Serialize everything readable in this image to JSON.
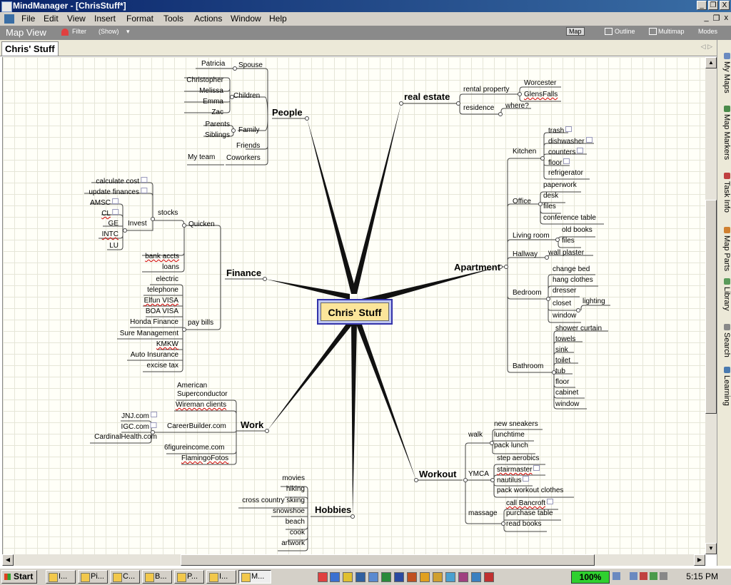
{
  "window": {
    "title": "MindManager - [ChrisStuff*]",
    "min": "_",
    "max": "❐",
    "close": "X"
  },
  "menu": [
    "File",
    "Edit",
    "View",
    "Insert",
    "Format",
    "Tools",
    "Actions",
    "Window",
    "Help"
  ],
  "mdi_controls": {
    "min": "_",
    "restore": "❐",
    "close": "x"
  },
  "viewbar": {
    "title": "Map View",
    "filter": "Filter",
    "show": "(Show)",
    "views": [
      "Map",
      "Outline",
      "Multimap"
    ],
    "modes": "Modes",
    "selected_view": "Map"
  },
  "document_tab": {
    "label": "Chris' Stuff",
    "nav": "◁ ▷"
  },
  "map": {
    "central": "Chris' Stuff",
    "people": {
      "label": "People",
      "spouse": "Spouse",
      "patricia": "Patricia",
      "children": "Children",
      "kids": [
        "Christopher",
        "Melissa",
        "Emma",
        "Zac"
      ],
      "family": "Family",
      "family_items": [
        "Parents",
        "Siblings"
      ],
      "friends": "Friends",
      "coworkers": "Coworkers",
      "myteam": "My team"
    },
    "finance": {
      "label": "Finance",
      "quicken": "Quicken",
      "stocks": "stocks",
      "stocks_items": [
        "calculate cost",
        "update finances"
      ],
      "invest": "Invest",
      "invest_items": [
        "AMSC",
        "CL",
        "GE",
        "INTC",
        "LU"
      ],
      "bank": "bank accts",
      "loans": "loans",
      "paybills": "pay bills",
      "bills": [
        "electric",
        "telephone",
        "Elfun VISA",
        "BOA VISA",
        "Honda Finance",
        "Sure Management",
        "KMKW",
        "Auto Insurance",
        "excise tax"
      ]
    },
    "work": {
      "label": "Work",
      "amsc1": "American",
      "amsc2": "Superconductor",
      "wireman": "Wireman clients",
      "careerbuilder": "CareerBuilder.com",
      "cb_items": [
        "JNJ.com",
        "IGC.com",
        "CardinalHealth.com"
      ],
      "sixfigure": "6figureincome.com",
      "flamingo": "FlamingoFotos"
    },
    "hobbies": {
      "label": "Hobbies",
      "items": [
        "movies",
        "hiking",
        "cross country skiing",
        "snowshoe",
        "beach",
        "cook",
        "artwork"
      ]
    },
    "realestate": {
      "label": "real estate",
      "rental": "rental property",
      "rental_items": [
        "Worcester",
        "GlensFalls"
      ],
      "residence": "residence",
      "where": "where?"
    },
    "apartment": {
      "label": "Apartment",
      "kitchen": "Kitchen",
      "kitchen_items": [
        "trash",
        "dishwasher",
        "counters",
        "floor",
        "refrigerator"
      ],
      "office": "Office",
      "office_items": [
        "paperwork",
        "desk",
        "files",
        "conference table"
      ],
      "living": "Living room",
      "living_items": [
        "old books",
        "files"
      ],
      "hallway": "Hallway",
      "wallplaster": "wall plaster",
      "bedroom": "Bedroom",
      "bedroom_items": [
        "change bed",
        "hang clothes",
        "dresser",
        "closet",
        "window"
      ],
      "lighting": "lighting",
      "bathroom": "Bathroom",
      "bathroom_items": [
        "shower curtain",
        "towels",
        "sink",
        "toilet",
        "tub",
        "floor",
        "cabinet",
        "window"
      ]
    },
    "workout": {
      "label": "Workout",
      "walk": "walk",
      "walk_items": [
        "new sneakers",
        "lunchtime",
        "pack lunch"
      ],
      "ymca": "YMCA",
      "ymca_items": [
        "step aerobics",
        "stairmaster",
        "nautilus",
        "pack workout clothes"
      ],
      "massage": "massage",
      "massage_items": [
        "call Bancroft",
        "purchase table",
        "read books"
      ]
    }
  },
  "sidepanel": [
    "My Maps",
    "Map Markers",
    "Task Info",
    "Map Parts",
    "Library",
    "Search",
    "Learning"
  ],
  "taskbar": {
    "start": "Start",
    "tasks": [
      "I...",
      "Pi...",
      "C...",
      "B...",
      "P...",
      "I...",
      "M..."
    ],
    "zoom": "100%",
    "clock": "5:15 PM"
  }
}
